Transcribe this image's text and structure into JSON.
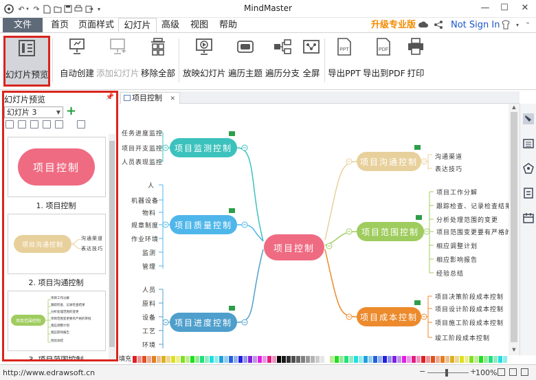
{
  "window": {
    "title": "MindMaster"
  },
  "menu": {
    "file": "文件",
    "tabs": [
      "首页",
      "页面样式",
      "幻灯片",
      "高级",
      "视图",
      "帮助"
    ],
    "upgrade": "升级专业版",
    "signin": "Not Sign In"
  },
  "ribbon": {
    "buttons": [
      {
        "label": "幻灯片预览",
        "icon": "slide-preview-icon"
      },
      {
        "label": "自动创建",
        "icon": "auto-create-icon"
      },
      {
        "label": "添加幻灯片",
        "icon": "add-slide-icon"
      },
      {
        "label": "移除全部",
        "icon": "remove-all-icon"
      },
      {
        "label": "放映幻灯片",
        "icon": "play-slides-icon"
      },
      {
        "label": "遍历主题",
        "icon": "traverse-topic-icon"
      },
      {
        "label": "遍历分支",
        "icon": "traverse-branch-icon"
      },
      {
        "label": "全屏",
        "icon": "fullscreen-icon"
      },
      {
        "label": "导出PPT",
        "icon": "export-ppt-icon",
        "badge": "PPT"
      },
      {
        "label": "导出到PDF",
        "icon": "export-pdf-icon",
        "badge": "PDF"
      },
      {
        "label": "打印",
        "icon": "print-icon"
      }
    ]
  },
  "left_panel": {
    "title": "幻灯片预览",
    "selected_slide": "幻灯片 3",
    "thumbs": [
      {
        "caption": "1. 项目控制",
        "main": "项目控制"
      },
      {
        "caption": "2. 项目沟通控制",
        "main": "项目沟通控制",
        "leaves": [
          "沟通渠道",
          "表达技巧"
        ]
      },
      {
        "caption": "3. 项目范围控制",
        "main": "项目范围控制",
        "leaves": [
          "项目工作分解",
          "跟踪检查、记录检查结果",
          "分析处理范围的变更",
          "项目范围变更要有严格的审批",
          "相应调整计划",
          "相应影响报告",
          "经验总结"
        ]
      }
    ]
  },
  "doc_tab": {
    "label": "项目控制",
    "close": "✕"
  },
  "mindmap": {
    "center": "项目控制",
    "branches": [
      {
        "label": "项目监测控制",
        "color": "#3cc2bd",
        "leaves": [
          "任务进度监控",
          "项目开支监控",
          "人员表现监控"
        ]
      },
      {
        "label": "项目质量控制",
        "color": "#4fb6ea",
        "leaves": [
          "人",
          "机器设备",
          "物料",
          "规章制度",
          "作业环境",
          "监测",
          "管理"
        ]
      },
      {
        "label": "项目进度控制",
        "color": "#4f9fcc",
        "leaves": [
          "人员",
          "原料",
          "设备",
          "工艺",
          "环境"
        ]
      },
      {
        "label": "项目沟通控制",
        "color": "#e8d09c",
        "leaves": [
          "沟通渠道",
          "表达技巧"
        ]
      },
      {
        "label": "项目范围控制",
        "color": "#9fcc5e",
        "leaves": [
          "项目工作分解",
          "跟踪检查、记录检查结果",
          "分析处理范围的变更",
          "项目范围变更要有严格的审批",
          "相应调整计划",
          "相应影响报告",
          "经验总结"
        ]
      },
      {
        "label": "项目成本控制",
        "color": "#ec8a2c",
        "leaves": [
          "项目决策阶段成本控制",
          "项目设计阶段成本控制",
          "项目施工阶段成本控制",
          "竣工阶段成本控制"
        ]
      }
    ],
    "center_color": "#ef6b82"
  },
  "colorbar": {
    "label": "填充"
  },
  "status": {
    "url": "http://www.edrawsoft.cn",
    "zoom": "100%"
  }
}
